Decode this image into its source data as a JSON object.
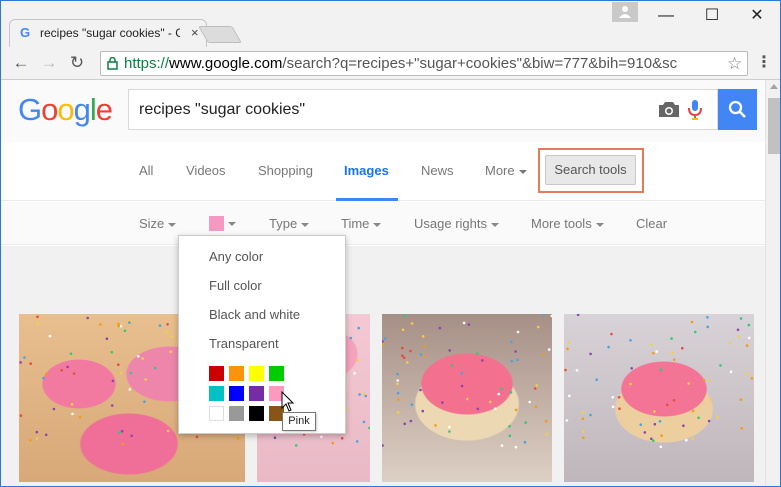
{
  "browser": {
    "tab_title": "recipes \"sugar cookies\" - G",
    "tab_close": "×",
    "window_minimize": "—",
    "window_maximize": "☐",
    "window_close": "✕",
    "url_protocol": "https://",
    "url_host": "www.google.com",
    "url_path": "/search?q=recipes+\"sugar+cookies\"&biw=777&bih=910&sc",
    "star": "☆",
    "menu": "⋮"
  },
  "search": {
    "logo": [
      "G",
      "o",
      "o",
      "g",
      "l",
      "e"
    ],
    "query": "recipes \"sugar cookies\""
  },
  "nav_tabs": [
    {
      "label": "All"
    },
    {
      "label": "Videos"
    },
    {
      "label": "Shopping"
    },
    {
      "label": "Images",
      "active": true
    },
    {
      "label": "News"
    },
    {
      "label": "More"
    }
  ],
  "search_tools_label": "Search tools",
  "tools": {
    "size": "Size",
    "type": "Type",
    "time": "Time",
    "usage_rights": "Usage rights",
    "more_tools": "More tools",
    "clear": "Clear",
    "selected_color": "#f49ac2"
  },
  "color_menu": {
    "any_color": "Any color",
    "full_color": "Full color",
    "black_and_white": "Black and white",
    "transparent": "Transparent",
    "swatches": [
      [
        "#cc0000",
        "#fb940b",
        "#ffff00",
        "#00cc00"
      ],
      [
        "#03c0c6",
        "#0000ff",
        "#762ca7",
        "#ff98bf"
      ],
      [
        "#ffffff",
        "#999999",
        "#000000",
        "#885418"
      ]
    ],
    "tooltip": "Pink"
  },
  "colors": {
    "accent": "#4285f4",
    "highlight": "#e8795b"
  }
}
